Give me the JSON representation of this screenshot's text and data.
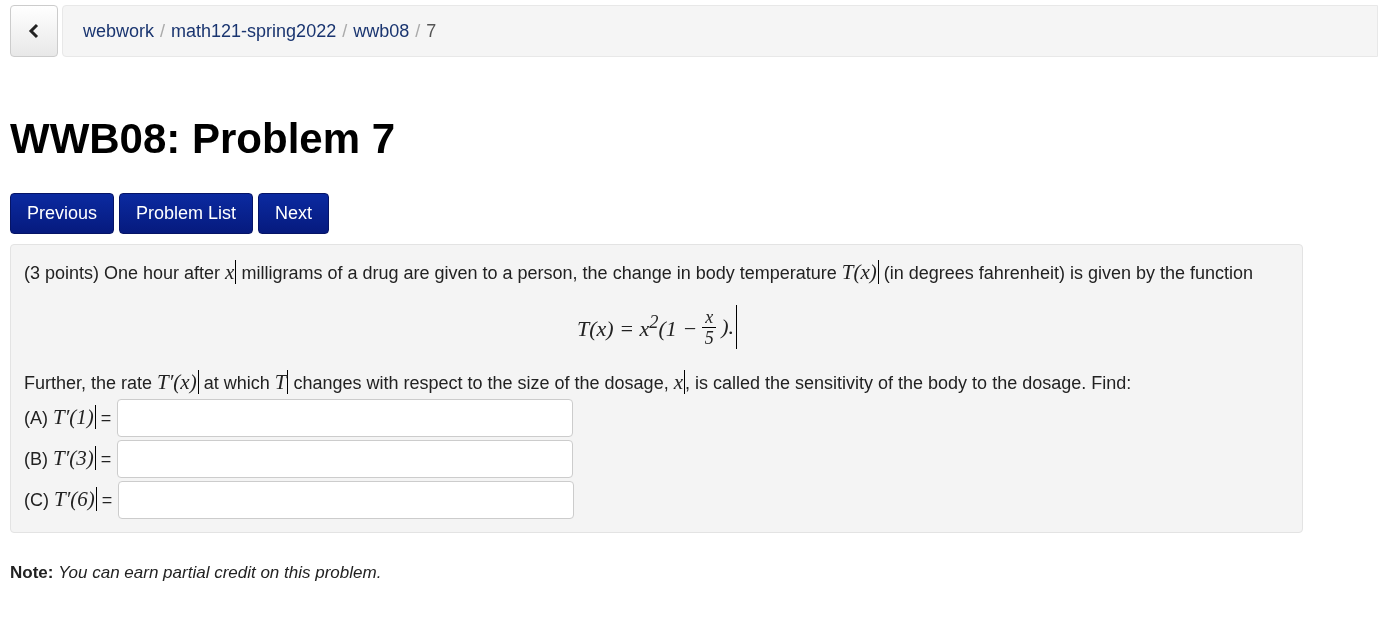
{
  "breadcrumb": [
    {
      "label": "webwork",
      "current": false
    },
    {
      "label": "math121-spring2022",
      "current": false
    },
    {
      "label": "wwb08",
      "current": false
    },
    {
      "label": "7",
      "current": true
    }
  ],
  "breadcrumb_separator": "/",
  "title": "WWB08: Problem 7",
  "nav_buttons": [
    "Previous",
    "Problem List",
    "Next"
  ],
  "problem": {
    "intro": [
      {
        "kind": "text",
        "text": "(3 points) One hour after "
      },
      {
        "kind": "math",
        "text": "x"
      },
      {
        "kind": "text",
        "text": " milligrams of a drug are given to a person, the change in body temperature "
      },
      {
        "kind": "math",
        "text": "T(x)"
      },
      {
        "kind": "text",
        "text": " (in degrees fahrenheit) is given by the function"
      }
    ],
    "equation": {
      "before": "T(x) = x$^{2}$(1 −",
      "numerator": "x",
      "denominator": "5",
      "after": ")."
    },
    "further": [
      {
        "kind": "text",
        "text": "Further, the rate "
      },
      {
        "kind": "math",
        "text": "T′(x)"
      },
      {
        "kind": "text",
        "text": " at which "
      },
      {
        "kind": "math",
        "text": "T"
      },
      {
        "kind": "text",
        "text": " changes with respect to the size of the dosage, "
      },
      {
        "kind": "math",
        "text": "x"
      },
      {
        "kind": "text",
        "text": ", is called the sensitivity of the body to the dosage. Find:"
      }
    ],
    "answers": [
      {
        "label": "(A)",
        "math": "T′(1)",
        "equals": "="
      },
      {
        "label": "(B)",
        "math": "T′(3)",
        "equals": "="
      },
      {
        "label": "(C)",
        "math": "T′(6)",
        "equals": "="
      }
    ]
  },
  "note": "**Note:** *You can earn partial credit on this problem.*"
}
